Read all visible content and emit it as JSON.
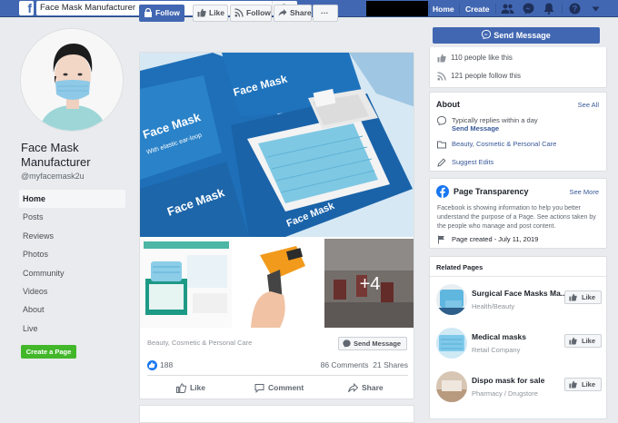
{
  "topbar": {
    "logo": "f",
    "search_value": "Face Mask Manufacturer",
    "nav_home": "Home",
    "nav_create": "Create",
    "icons": [
      "friends-icon",
      "messenger-icon",
      "notifications-icon",
      "help-icon",
      "dropdown-icon"
    ],
    "brand_color": "#4267b2"
  },
  "profile": {
    "name": "Face Mask Manufacturer",
    "handle": "@myfacemask2u"
  },
  "left_nav": {
    "items": [
      "Home",
      "Posts",
      "Reviews",
      "Photos",
      "Community",
      "Videos",
      "About",
      "Live"
    ],
    "active": "Home",
    "create_page": "Create a Page"
  },
  "page_actions": {
    "follow": "Follow",
    "like": "Like",
    "follow2": "Follow",
    "share": "Share",
    "more": "···",
    "send_message": "Send Message"
  },
  "stats": {
    "likes": "110 people like this",
    "follows": "121 people follow this"
  },
  "about": {
    "title": "About",
    "see_all": "See All",
    "reply_text": "Typically replies within a day",
    "send_message": "Send Message",
    "category": "Beauty, Cosmetic & Personal Care",
    "suggest_edits": "Suggest Edits"
  },
  "transparency": {
    "title": "Page Transparency",
    "see_more": "See More",
    "description": "Facebook is showing information to help you better understand the purpose of a Page. See actions taken by the people who manage and post content.",
    "created": "Page created - July 11, 2019"
  },
  "related": {
    "title": "Related Pages",
    "items": [
      {
        "name": "Surgical Face Masks Ma...",
        "category": "Health/Beauty",
        "like": "Like"
      },
      {
        "name": "Medical masks",
        "category": "Retail Company",
        "like": "Like"
      },
      {
        "name": "Dispo mask for sale",
        "category": "Pharmacy / Drugstore",
        "like": "Like"
      }
    ]
  },
  "post": {
    "box_text": "Face Mask",
    "box_sub": "With elastic ear-loop",
    "more_photos": "+4",
    "category": "Beauty, Cosmetic & Personal Care",
    "send_message": "Send Message",
    "reactions": "188",
    "comments": "86 Comments",
    "shares": "21 Shares",
    "like": "Like",
    "comment": "Comment",
    "share": "Share"
  }
}
